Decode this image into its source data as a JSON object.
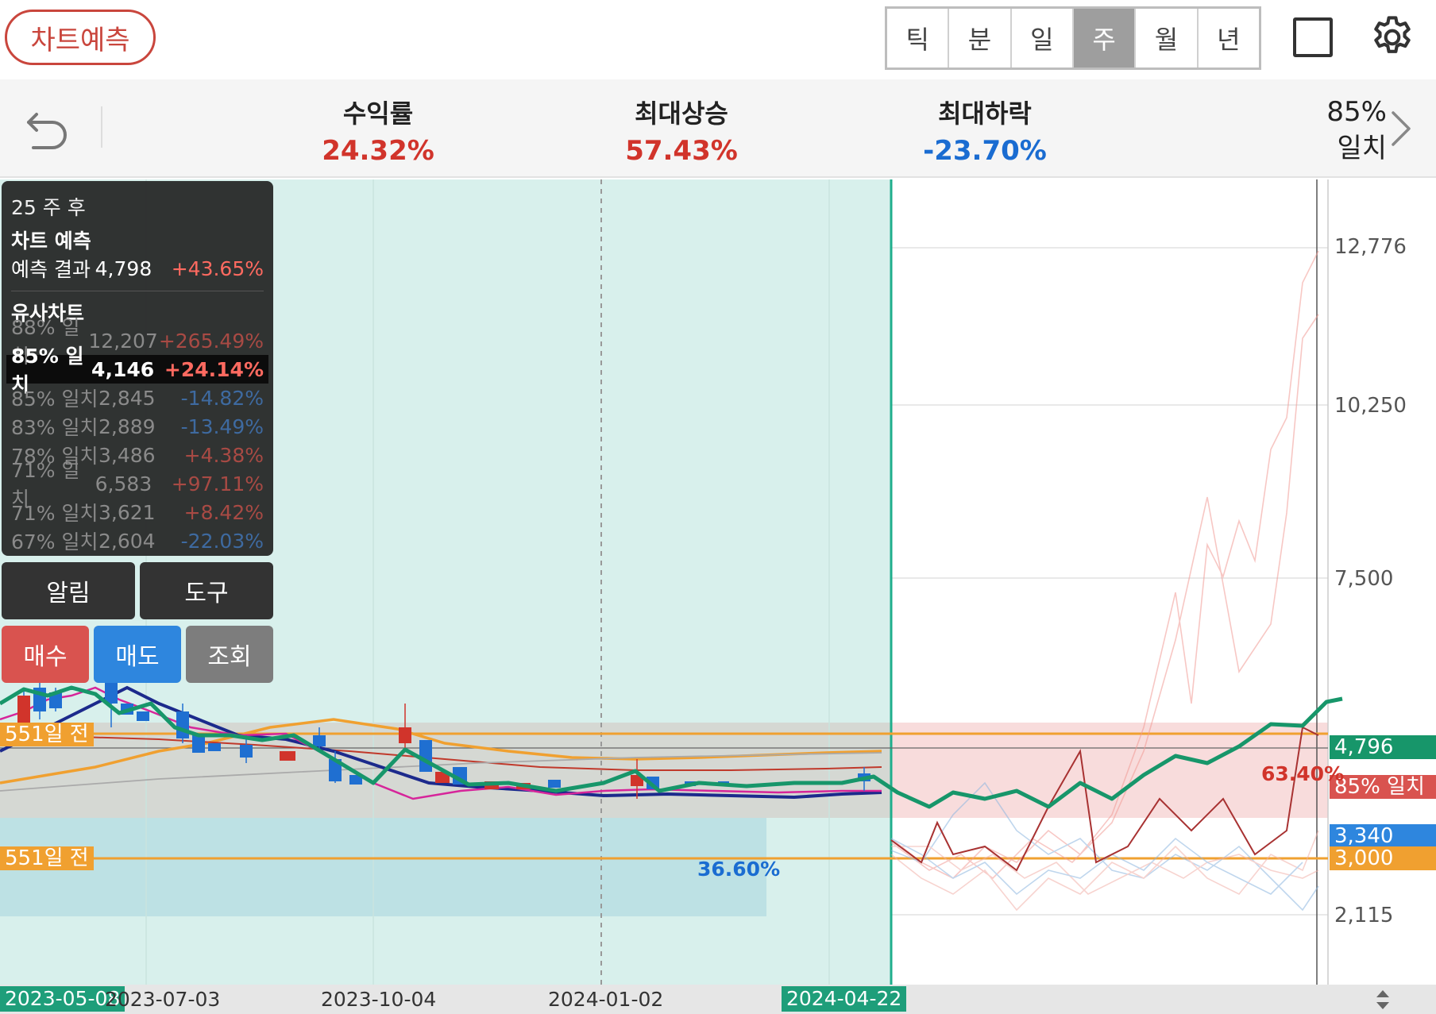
{
  "topbar": {
    "predict_label": "차트예측",
    "periods": [
      "틱",
      "분",
      "일",
      "주",
      "월",
      "년"
    ],
    "active_period": "주"
  },
  "stats": {
    "return_label": "수익률",
    "return_value": "24.32%",
    "max_rise_label": "최대상승",
    "max_rise_value": "57.43%",
    "max_drop_label": "최대하락",
    "max_drop_value": "-23.70%",
    "match_pct": "85%",
    "match_label": "일치"
  },
  "panel": {
    "weeks": "25 주 후",
    "title": "차트 예측",
    "result_label": "예측 결과",
    "result_price": "4,798",
    "result_change": "+43.65%",
    "similar_title": "유사차트",
    "rows": [
      {
        "match": "88% 일치",
        "price": "12,207",
        "change": "+265.49%",
        "dir": "pos"
      },
      {
        "match": "85% 일치",
        "price": "4,146",
        "change": "+24.14%",
        "dir": "pos",
        "selected": true
      },
      {
        "match": "85% 일치",
        "price": "2,845",
        "change": "-14.82%",
        "dir": "neg"
      },
      {
        "match": "83% 일치",
        "price": "2,889",
        "change": "-13.49%",
        "dir": "neg"
      },
      {
        "match": "78% 일치",
        "price": "3,486",
        "change": "+4.38%",
        "dir": "pos"
      },
      {
        "match": "71% 일치",
        "price": "6,583",
        "change": "+97.11%",
        "dir": "pos"
      },
      {
        "match": "71% 일치",
        "price": "3,621",
        "change": "+8.42%",
        "dir": "pos"
      },
      {
        "match": "67% 일치",
        "price": "2,604",
        "change": "-22.03%",
        "dir": "neg"
      }
    ]
  },
  "buttons": {
    "alert": "알림",
    "tools": "도구",
    "buy": "매수",
    "sell": "매도",
    "inquiry": "조회"
  },
  "chart": {
    "y_ticks": [
      "12,776",
      "10,250",
      "7,500",
      "2,115"
    ],
    "price_tags": {
      "current": "4,796",
      "match_label": "85% 일치",
      "low_a": "3,340",
      "low_b": "3,000"
    },
    "band_labels": {
      "upper": "551일 전",
      "lower": "551일 전"
    },
    "range_pct": "36.60%",
    "forecast_pct": "63.40%",
    "x_labels": [
      "2023-05-08",
      "2023-07-03",
      "2023-10-04",
      "2024-01-02",
      "2024-04-22"
    ],
    "colors": {
      "up": "#d1342b",
      "down": "#1f6fd1",
      "forecast": "#1a9a6c",
      "band": "#f0a030"
    }
  },
  "chart_data": {
    "type": "line",
    "x": [
      "2023-05-08",
      "2023-07-03",
      "2023-10-04",
      "2024-01-02",
      "2024-04-22"
    ],
    "ylim": [
      1500,
      13500
    ],
    "y_ticks": [
      2115,
      3000,
      3340,
      4796,
      7500,
      10250,
      12776
    ],
    "series": [
      {
        "name": "85% 일치",
        "values": [
          3340,
          3200,
          3450,
          3700,
          4146
        ]
      }
    ]
  }
}
